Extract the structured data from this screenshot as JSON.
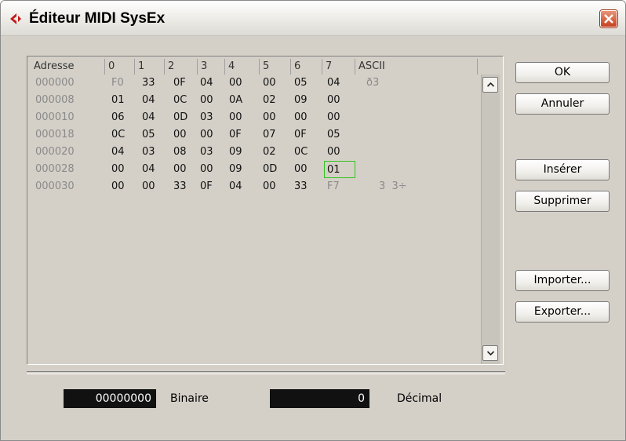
{
  "window": {
    "title": "Éditeur MIDI SysEx"
  },
  "grid": {
    "columns": [
      "Adresse",
      "0",
      "1",
      "2",
      "3",
      "4",
      "5",
      "6",
      "7",
      "ASCII"
    ],
    "rows": [
      {
        "address": "000000",
        "bytes": [
          "F0",
          "33",
          "0F",
          "04",
          "00",
          "00",
          "05",
          "04"
        ],
        "ascii": "ð3"
      },
      {
        "address": "000008",
        "bytes": [
          "01",
          "04",
          "0C",
          "00",
          "0A",
          "02",
          "09",
          "00"
        ],
        "ascii": ""
      },
      {
        "address": "000010",
        "bytes": [
          "06",
          "04",
          "0D",
          "03",
          "00",
          "00",
          "00",
          "00"
        ],
        "ascii": ""
      },
      {
        "address": "000018",
        "bytes": [
          "0C",
          "05",
          "00",
          "00",
          "0F",
          "07",
          "0F",
          "05"
        ],
        "ascii": ""
      },
      {
        "address": "000020",
        "bytes": [
          "04",
          "03",
          "08",
          "03",
          "09",
          "02",
          "0C",
          "00"
        ],
        "ascii": ""
      },
      {
        "address": "000028",
        "bytes": [
          "00",
          "04",
          "00",
          "00",
          "09",
          "0D",
          "00",
          "01"
        ],
        "ascii": ""
      },
      {
        "address": "000030",
        "bytes": [
          "00",
          "00",
          "33",
          "0F",
          "04",
          "00",
          "33",
          "F7"
        ],
        "ascii": "3  3÷"
      }
    ]
  },
  "buttons": {
    "ok": "OK",
    "cancel": "Annuler",
    "insert": "Insérer",
    "delete": "Supprimer",
    "import": "Importer...",
    "export": "Exporter..."
  },
  "fields": {
    "binary_value": "00000000",
    "binary_label": "Binaire",
    "decimal_value": "0",
    "decimal_label": "Décimal"
  },
  "colors": {
    "selection": "#33c21f",
    "close_button": "#c7421e",
    "app_icon": "#c21b1b"
  }
}
